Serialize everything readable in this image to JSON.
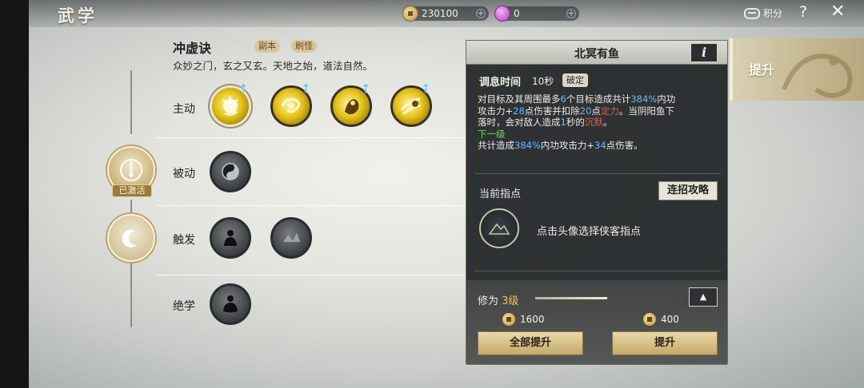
{
  "header": {
    "title": "武学",
    "coins": "230100",
    "gems": "0",
    "score_label": "积分",
    "help_label": "?",
    "close_label": "✕"
  },
  "skill": {
    "name": "冲虚诀",
    "tags": [
      "副本",
      "刷怪"
    ],
    "description": "众妙之门，玄之又玄。天地之始，道法自然。"
  },
  "categories": [
    {
      "label": "主动"
    },
    {
      "label": "被动"
    },
    {
      "label": "触发"
    },
    {
      "label": "绝学"
    }
  ],
  "activated_badge": "已激活",
  "detail": {
    "title": "北冥有鱼",
    "info_label": "i",
    "cooldown_label": "调息时间",
    "cooldown_value": "10秒",
    "break_badge": "破定",
    "desc": {
      "l1_a": "对目标及其周围最多",
      "l1_n1": "6",
      "l1_b": "个目标造成共计",
      "l1_n2": "384%",
      "l1_c": "内功",
      "l2_a": "攻击力+",
      "l2_n1": "28",
      "l2_b": "点伤害并扣除",
      "l2_n2": "20",
      "l2_c": "点",
      "l2_red": "定力",
      "l2_d": "。当阴阳鱼下",
      "l3_a": "落时，会对敌人造成",
      "l3_n1": "1",
      "l3_b": "秒的",
      "l3_red": "沉默",
      "l3_c": "。",
      "next_level": "下一级",
      "l5_a": "共计造成",
      "l5_n1": "384%",
      "l5_b": "内功攻击力+",
      "l5_n2": "34",
      "l5_c": "点伤害。"
    },
    "pointer_label": "当前指点",
    "combo_button": "连招攻略",
    "pointer_hint": "点击头像选择侠客指点",
    "level_prefix": "修为",
    "level_value": "3级",
    "level_progress": 0.53,
    "cost_1": "1600",
    "cost_2": "400",
    "upgrade_all_button": "全部提升",
    "upgrade_button": "提升"
  },
  "side_tab": {
    "label": "提升"
  }
}
